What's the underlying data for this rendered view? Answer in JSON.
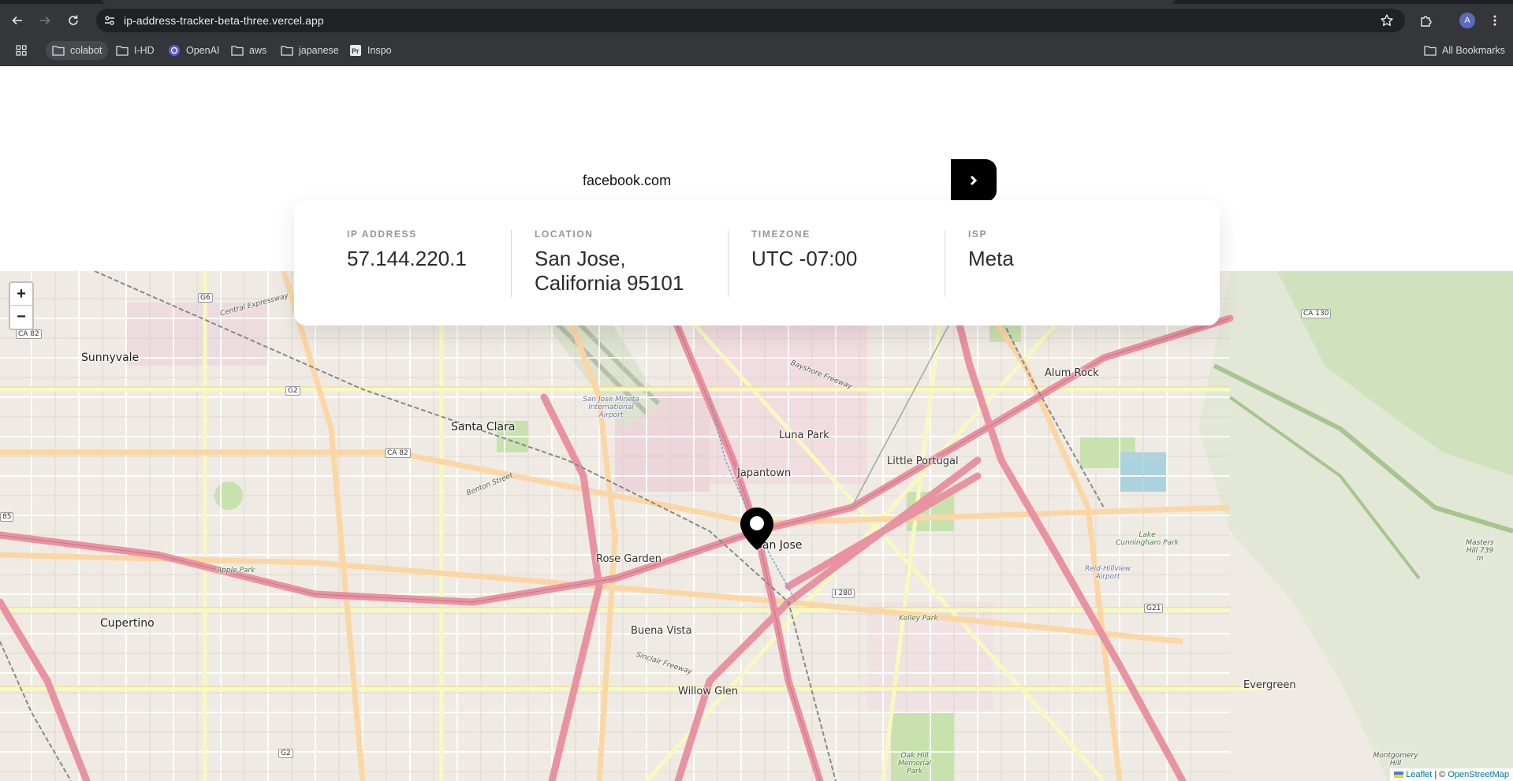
{
  "browser": {
    "url": "ip-address-tracker-beta-three.vercel.app",
    "profile_initial": "A",
    "bookmarks": [
      {
        "label": "colabot",
        "icon": "folder-icon"
      },
      {
        "label": "I-HD",
        "icon": "folder-icon"
      },
      {
        "label": "OpenAI",
        "icon": "openai-icon"
      },
      {
        "label": "aws",
        "icon": "folder-icon"
      },
      {
        "label": "japanese",
        "icon": "folder-icon"
      },
      {
        "label": "Inspo",
        "icon": "portfolio-icon"
      }
    ],
    "all_bookmarks_label": "All Bookmarks"
  },
  "search": {
    "value": "facebook.com",
    "button_icon": "chevron-right-icon"
  },
  "info": {
    "ip": {
      "label": "IP ADDRESS",
      "value": "57.144.220.1"
    },
    "location": {
      "label": "LOCATION",
      "value_line1": "San Jose,",
      "value_line2": "California 95101"
    },
    "timezone": {
      "label": "TIMEZONE",
      "value": "UTC -07:00"
    },
    "isp": {
      "label": "ISP",
      "value": "Meta"
    }
  },
  "map": {
    "zoom_in": "+",
    "zoom_out": "−",
    "attribution_leaflet": "Leaflet",
    "attribution_sep": "| ©",
    "attribution_osm": "OpenStreetMap",
    "labels": {
      "sunnyvale": "Sunnyvale",
      "santa_clara": "Santa Clara",
      "cupertino": "Cupertino",
      "rose_garden": "Rose Garden",
      "buena_vista": "Buena Vista",
      "willow_glen": "Willow Glen",
      "luna_park": "Luna Park",
      "japantown": "Japantown",
      "little_portugal": "Little Portugal",
      "alum_rock": "Alum Rock",
      "evergreen": "Evergreen",
      "san_jose": "San Jose",
      "airport": "San Jose Mineta International Airport",
      "reid_hillview": "Reid-Hillview Airport",
      "lake_cunningham": "Lake Cunningham Park",
      "kelley_park": "Kelley Park",
      "apple_park": "Apple Park",
      "masters_hill": "Masters Hill 739 m",
      "montgomery_hill": "Montgomery Hill",
      "oak_hill": "Oak Hill Memorial Park",
      "central_expressway": "Central Expressway",
      "bayshore": "Bayshore Freeway",
      "sinclair": "Sinclair Freeway",
      "benton": "Benton Street"
    },
    "shields": {
      "ca82a": "CA 82",
      "ca82b": "CA 82",
      "g6": "G6",
      "g2a": "G2",
      "g2b": "G2",
      "i280": "I 280",
      "g21": "G21",
      "ca130": "CA 130",
      "r85": "85"
    }
  }
}
